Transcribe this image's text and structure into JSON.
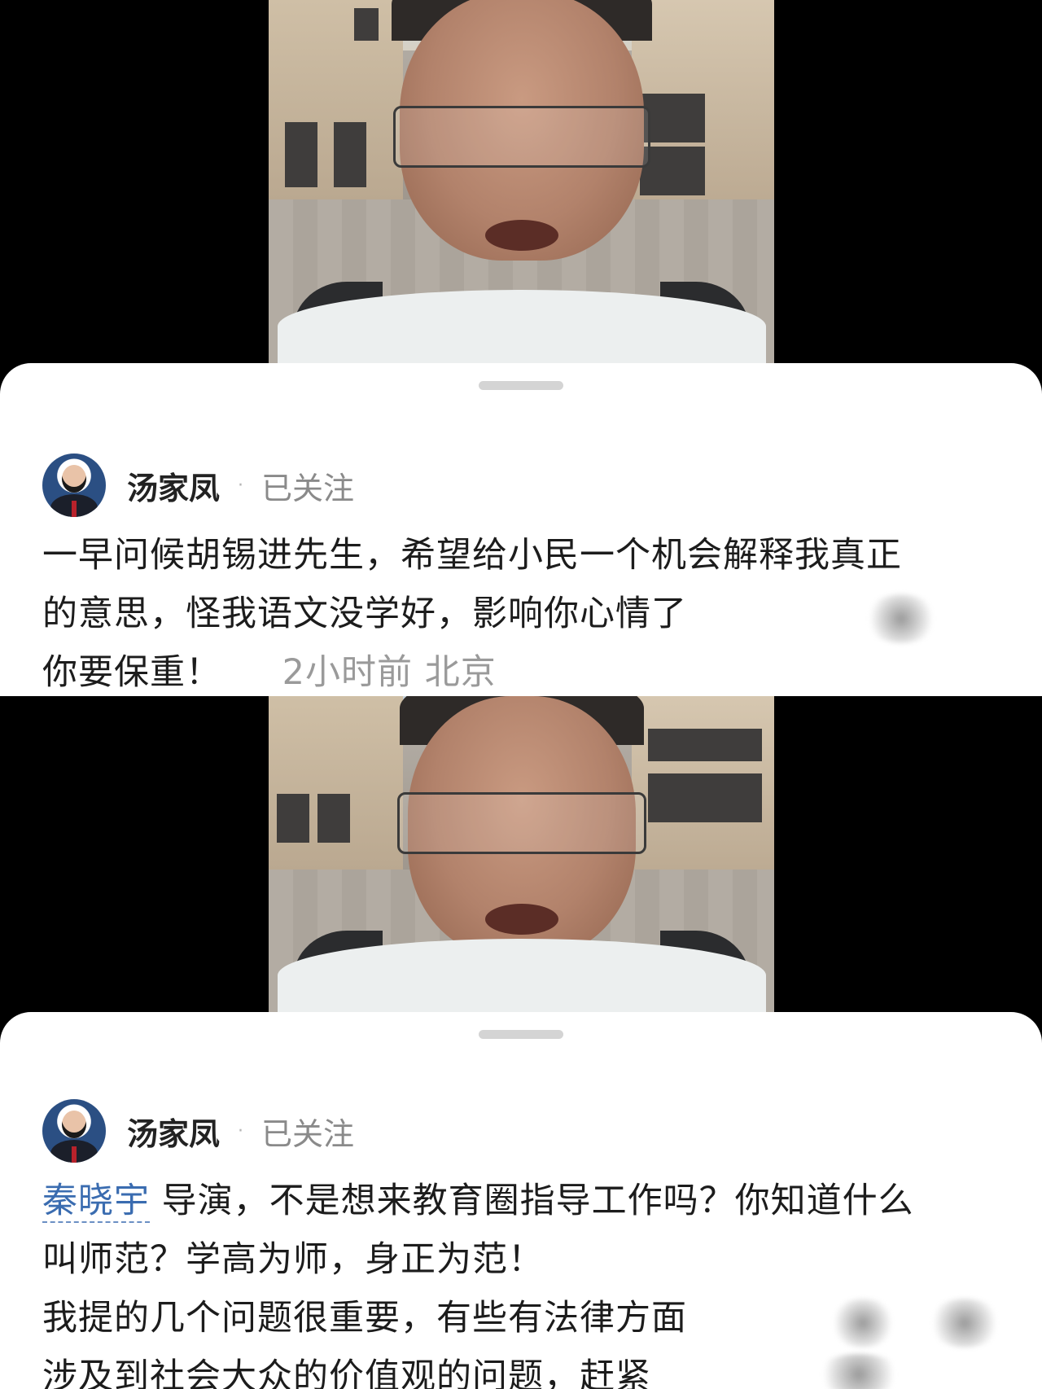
{
  "post_1": {
    "author": "汤家凤",
    "dot": "·",
    "follow_status": "已关注",
    "lines": [
      "一早问候胡锡进先生，希望给小民一个机会解释我真正",
      "的意思，怪我语文没学好，影响你心情了",
      "你要保重！"
    ],
    "time": "2小时前",
    "location": "北京"
  },
  "post_2": {
    "author": "汤家凤",
    "dot": "·",
    "follow_status": "已关注",
    "mention": "秦晓宇",
    "line1_rest": "导演，不是想来教育圈指导工作吗？你知道什么",
    "lines": [
      "叫师范？学高为师，身正为范！",
      "我提的几个问题很重要，有些有法律方面",
      "涉及到社会大众的价值观的问题，赶紧"
    ]
  }
}
